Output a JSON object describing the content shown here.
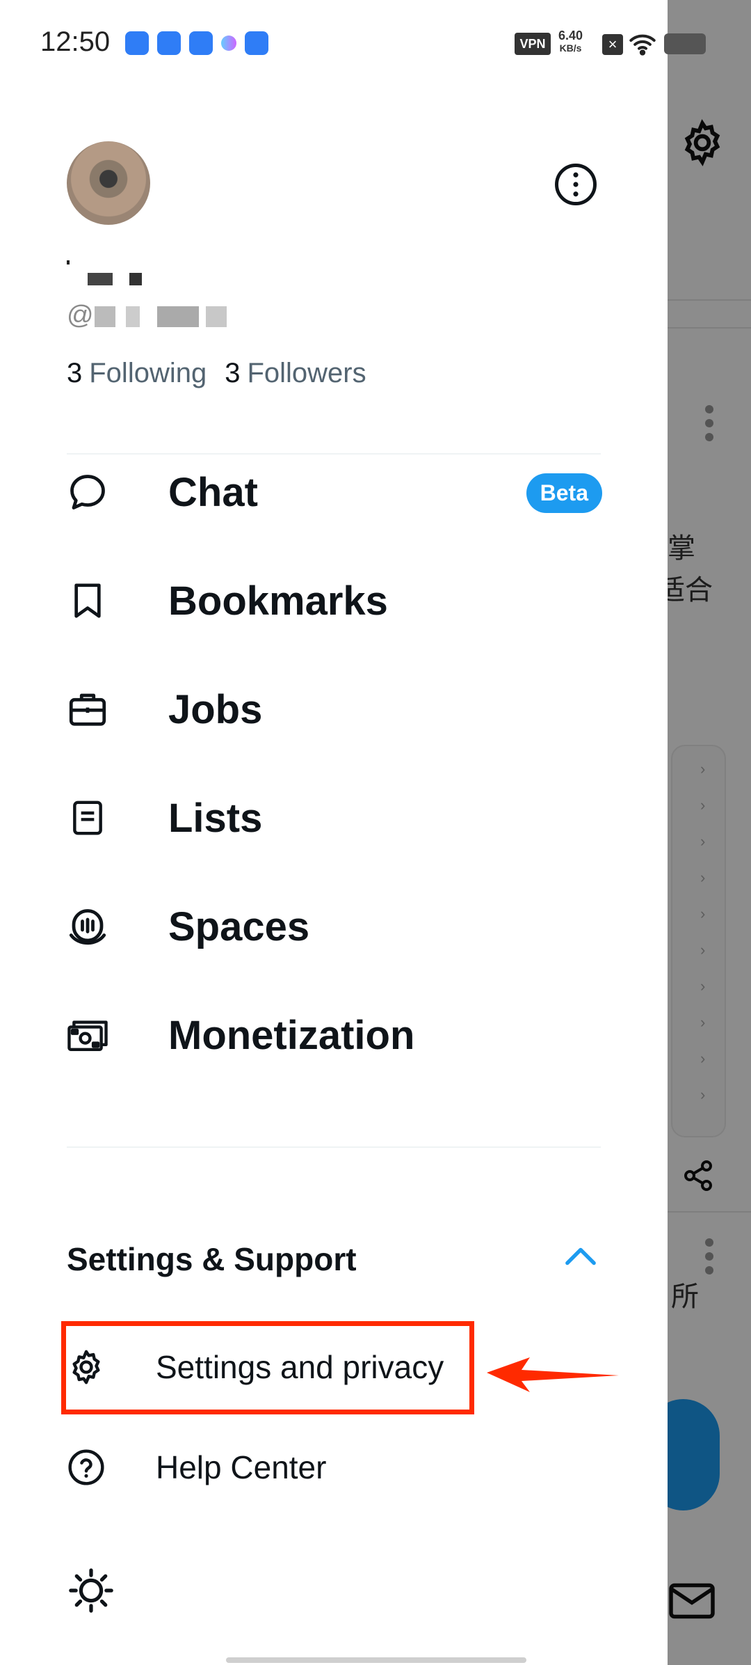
{
  "status_bar": {
    "time": "12:50",
    "vpn": "VPN",
    "speed_value": "6.40",
    "speed_unit": "KB/s"
  },
  "profile": {
    "following_count": "3",
    "following_label": "Following",
    "followers_count": "3",
    "followers_label": "Followers",
    "handle_prefix": "@"
  },
  "menu": {
    "items": [
      {
        "label": "Chat",
        "icon": "chat-icon",
        "badge": "Beta"
      },
      {
        "label": "Bookmarks",
        "icon": "bookmark-icon"
      },
      {
        "label": "Jobs",
        "icon": "briefcase-icon"
      },
      {
        "label": "Lists",
        "icon": "list-icon"
      },
      {
        "label": "Spaces",
        "icon": "spaces-icon"
      },
      {
        "label": "Monetization",
        "icon": "money-icon"
      }
    ]
  },
  "settings_support": {
    "title": "Settings & Support",
    "items": [
      {
        "label": "Settings and privacy",
        "icon": "gear-icon"
      },
      {
        "label": "Help Center",
        "icon": "help-icon"
      }
    ]
  },
  "background": {
    "cn_text_1": "掌",
    "cn_text_2": "适合",
    "cn_text_3": "所"
  },
  "colors": {
    "accent": "#1d9bf0",
    "highlight": "#ff2a00"
  }
}
